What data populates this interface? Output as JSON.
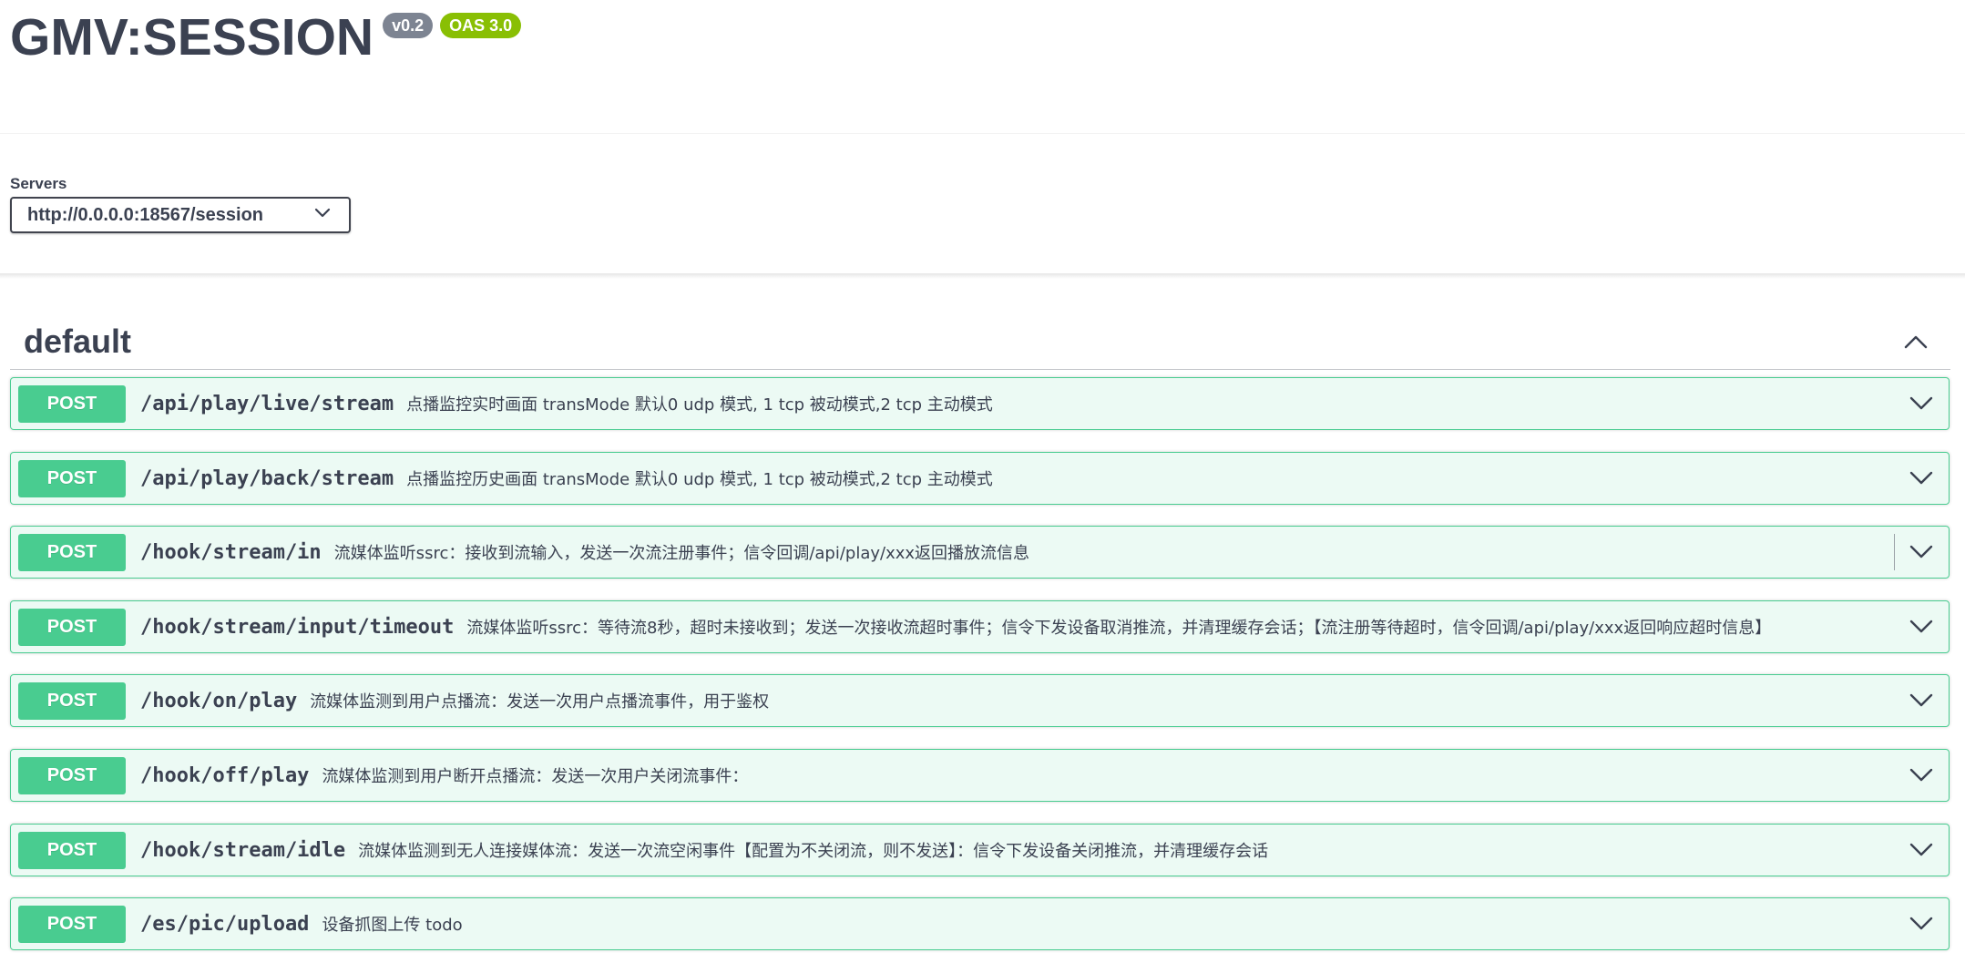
{
  "info": {
    "title": "GMV:SESSION",
    "version_badge": "v0.2",
    "oas_badge": "OAS 3.0"
  },
  "servers": {
    "label": "Servers",
    "selected": "http://0.0.0.0:18567/session"
  },
  "section": {
    "title": "default",
    "expanded": true
  },
  "operations": [
    {
      "method": "POST",
      "path": "/api/play/live/stream",
      "summary": "点播监控实时画面 transMode 默认0 udp 模式, 1 tcp 被动模式,2 tcp 主动模式"
    },
    {
      "method": "POST",
      "path": "/api/play/back/stream",
      "summary": "点播监控历史画面 transMode 默认0 udp 模式, 1 tcp 被动模式,2 tcp 主动模式"
    },
    {
      "method": "POST",
      "path": "/hook/stream/in",
      "summary": "流媒体监听ssrc：接收到流输入，发送一次流注册事件；信令回调/api/play/xxx返回播放流信息"
    },
    {
      "method": "POST",
      "path": "/hook/stream/input/timeout",
      "summary": "流媒体监听ssrc：等待流8秒，超时未接收到；发送一次接收流超时事件；信令下发设备取消推流，并清理缓存会话；【流注册等待超时，信令回调/api/play/xxx返回响应超时信息】"
    },
    {
      "method": "POST",
      "path": "/hook/on/play",
      "summary": "流媒体监测到用户点播流：发送一次用户点播流事件，用于鉴权"
    },
    {
      "method": "POST",
      "path": "/hook/off/play",
      "summary": "流媒体监测到用户断开点播流：发送一次用户关闭流事件："
    },
    {
      "method": "POST",
      "path": "/hook/stream/idle",
      "summary": "流媒体监测到无人连接媒体流：发送一次流空闲事件【配置为不关闭流，则不发送】：信令下发设备关闭推流，并清理缓存会话"
    },
    {
      "method": "POST",
      "path": "/es/pic/upload",
      "summary": "设备抓图上传 todo"
    }
  ],
  "colors": {
    "post": "#49cc90",
    "text": "#3b4151",
    "version_badge": "#7d8492",
    "oas_badge": "#89bf04"
  },
  "icons": {
    "server_dropdown": "chevron-down-icon",
    "section_toggle": "chevron-up-icon",
    "operation_toggle": "chevron-down-icon"
  }
}
